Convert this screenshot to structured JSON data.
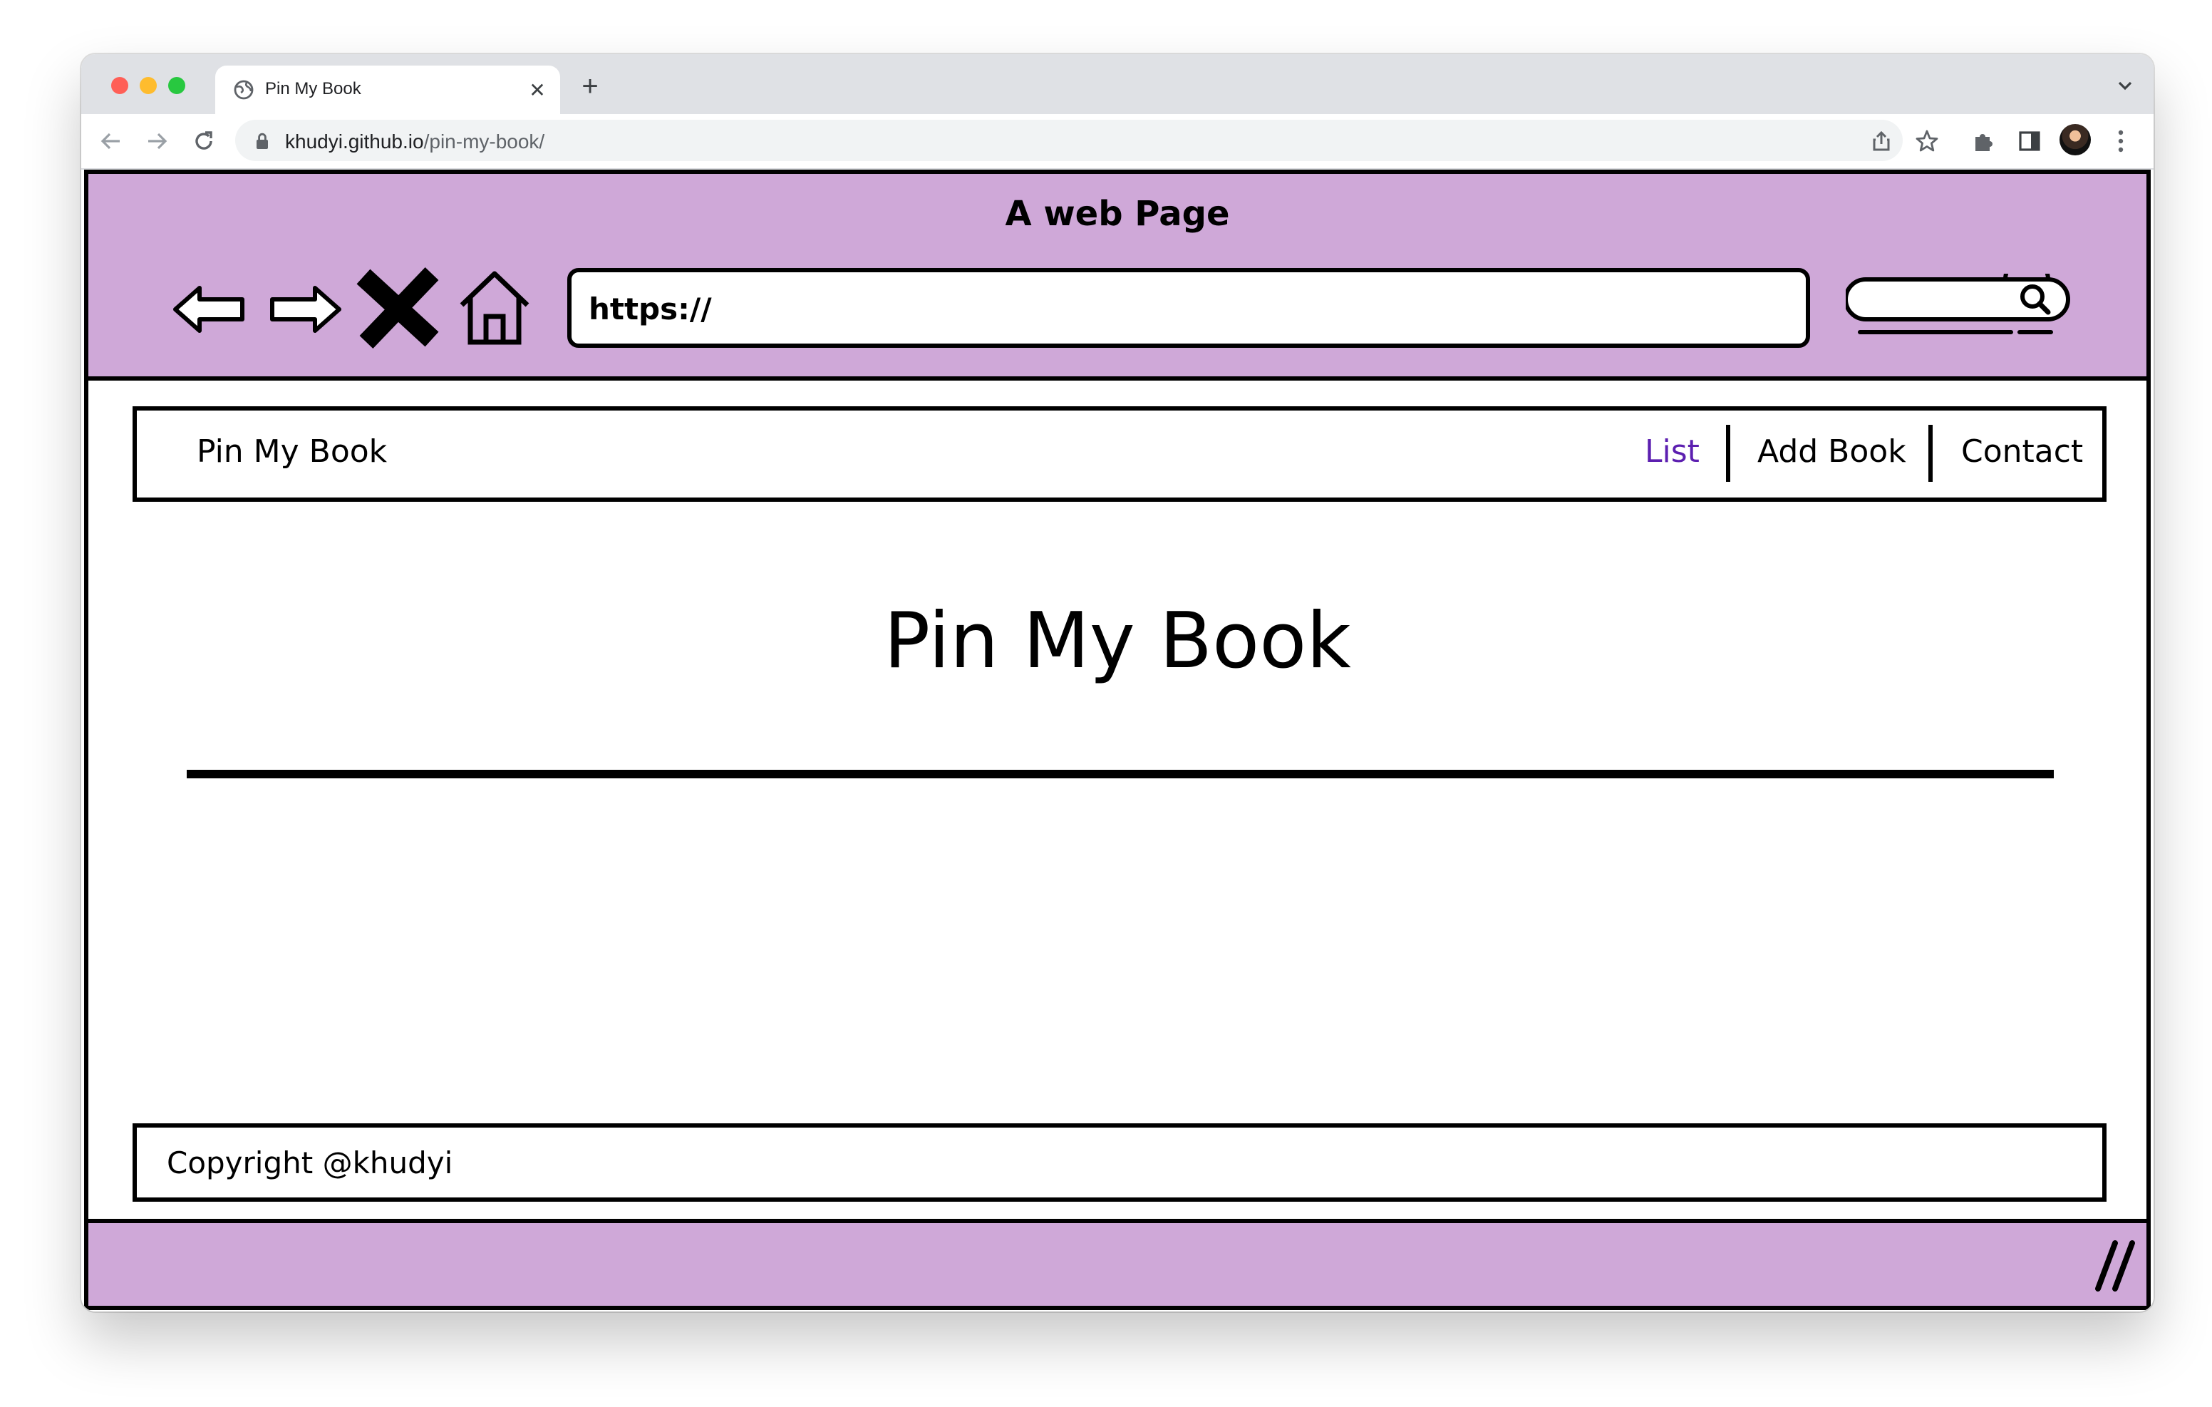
{
  "browser": {
    "tab": {
      "title": "Pin My Book",
      "favicon": "globe-icon",
      "close_icon": "close-icon"
    },
    "new_tab_icon": "plus-icon",
    "tab_search_icon": "chevron-down-icon",
    "nav_icons": [
      "back-arrow-icon",
      "forward-arrow-icon",
      "reload-icon"
    ],
    "address": {
      "host": "khudyi.github.io",
      "path": "/pin-my-book/",
      "lock_icon": "lock-icon"
    },
    "toolbar_icons": [
      "share-icon",
      "bookmark-star-icon",
      "extensions-puzzle-icon",
      "side-panel-icon",
      "profile-avatar",
      "more-menu-icon"
    ]
  },
  "sketch_frame": {
    "title": "A web Page",
    "url_text": "https://",
    "icons": [
      "back-arrow-icon",
      "forward-arrow-icon",
      "stop-x-icon",
      "home-icon",
      "search-icon"
    ],
    "colors": {
      "frame_purple": "#cfa8d8",
      "ink": "#000000"
    }
  },
  "site": {
    "brand": "Pin My Book",
    "nav": [
      {
        "label": "List",
        "active": true
      },
      {
        "label": "Add Book",
        "active": false
      },
      {
        "label": "Contact",
        "active": false
      }
    ],
    "active_link_color": "#5c1fb0",
    "heading": "Pin My Book",
    "footer": "Copyright @khudyi"
  }
}
